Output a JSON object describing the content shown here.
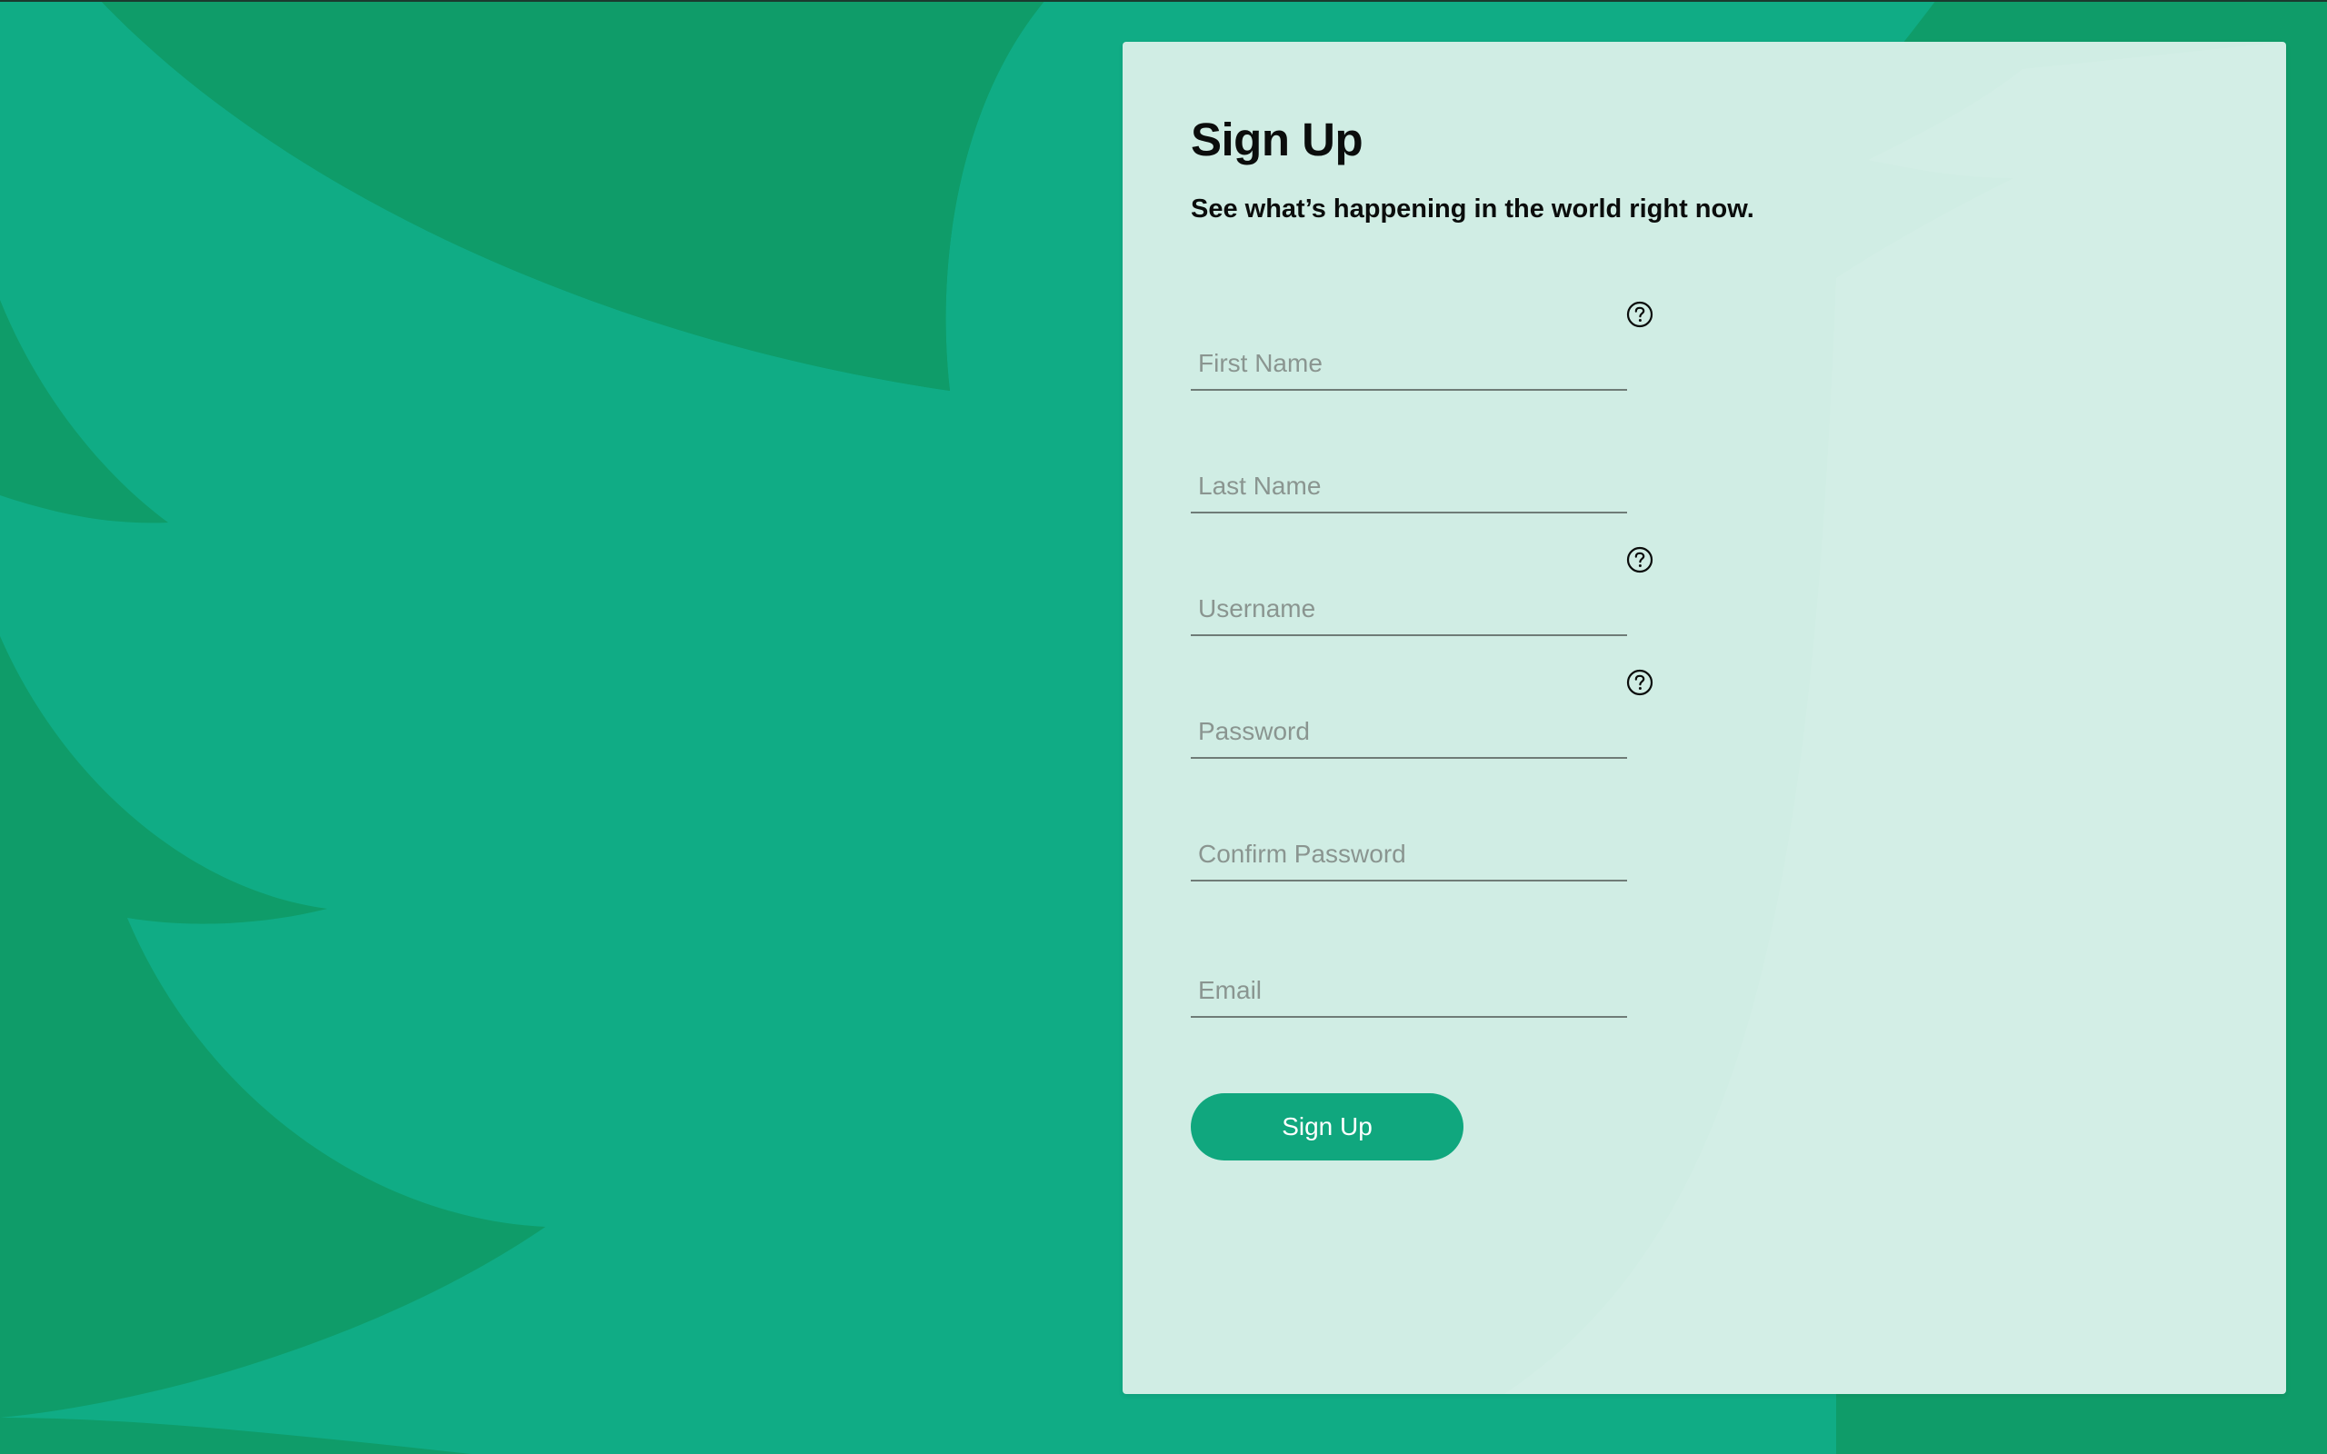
{
  "colors": {
    "background": "#0f9c69",
    "background_light": "#10ac85",
    "panel": "#d0ede4",
    "accent": "#10a77e",
    "text": "#0b0d0c",
    "placeholder": "#8a9590"
  },
  "form": {
    "title": "Sign Up",
    "subtitle": "See what’s happening in the world right now.",
    "fields": [
      {
        "placeholder": "First Name",
        "value": "",
        "has_help": true,
        "help_icon": "help-circle-icon"
      },
      {
        "placeholder": "Last Name",
        "value": "",
        "has_help": false
      },
      {
        "placeholder": "Username",
        "value": "",
        "has_help": true,
        "help_icon": "help-circle-icon"
      },
      {
        "placeholder": "Password",
        "value": "",
        "has_help": true,
        "help_icon": "help-circle-icon"
      },
      {
        "placeholder": "Confirm Password",
        "value": "",
        "has_help": false
      },
      {
        "placeholder": "Email",
        "value": "",
        "has_help": false
      }
    ],
    "submit_label": "Sign Up"
  }
}
